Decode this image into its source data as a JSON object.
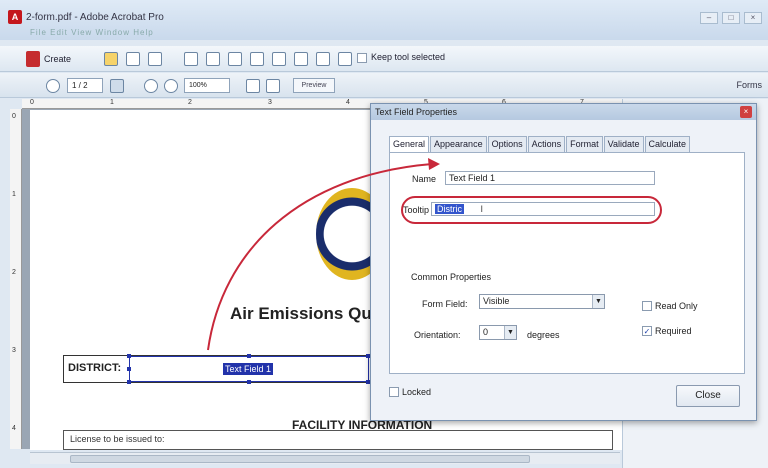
{
  "window": {
    "title": "2-form.pdf - Adobe Acrobat Pro",
    "menus": "File  Edit  View  Window  Help",
    "controls": [
      "–",
      "□",
      "×"
    ]
  },
  "toolbar": {
    "create_label": "Create",
    "keep_tool_label": "Keep tool selected",
    "page_value": "1 / 2",
    "zoom_value": "100%",
    "preview_label": "Preview",
    "forms_label": "Forms"
  },
  "rulers": {
    "top": [
      "0",
      "1",
      "2",
      "3",
      "4",
      "5",
      "6",
      "7"
    ],
    "left": [
      "0",
      "1",
      "2",
      "3",
      "4"
    ]
  },
  "document": {
    "heading": "Air Emissions Qu",
    "district_label": "DISTRICT:",
    "district_field_text": "Text Field 1",
    "facility_heading": "FACILITY INFORMATION",
    "license_label": "License to be issued to:"
  },
  "dialog": {
    "title": "Text Field Properties",
    "close_icon": "×",
    "tabs": [
      "General",
      "Appearance",
      "Options",
      "Actions",
      "Format",
      "Validate",
      "Calculate"
    ],
    "name_label": "Name",
    "name_value": "Text Field 1",
    "tooltip_label": "Tooltip",
    "tooltip_value": "Distric",
    "common_properties_label": "Common Properties",
    "form_field_label": "Form Field:",
    "form_field_value": "Visible",
    "orientation_label": "Orientation:",
    "orientation_value": "0",
    "degrees_label": "degrees",
    "read_only_label": "Read Only",
    "read_only_checked": false,
    "required_label": "Required",
    "required_checked": true,
    "locked_label": "Locked",
    "locked_checked": false,
    "close_button": "Close"
  },
  "colors": {
    "annotation": "#c8283a",
    "selection": "#2233aa"
  }
}
